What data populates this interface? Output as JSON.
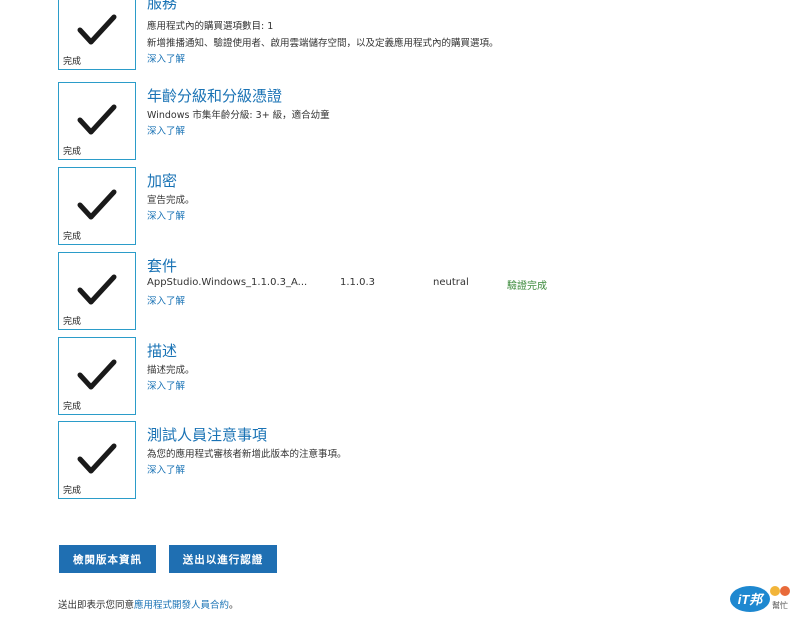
{
  "check_status_label": "完成",
  "sections": [
    {
      "title": "服務",
      "lines": [
        "應用程式內的購買選項數目: 1",
        "新增推播通知、驗證使用者、啟用雲端儲存空間，以及定義應用程式內的購買選項。"
      ],
      "link": "深入了解"
    },
    {
      "title": "年齡分級和分級憑證",
      "lines": [
        "Windows 市集年齡分級: 3+ 級，適合幼童"
      ],
      "link": "深入了解"
    },
    {
      "title": "加密",
      "lines": [
        "宣告完成。"
      ],
      "link": "深入了解"
    },
    {
      "title": "套件",
      "package": {
        "name": "AppStudio.Windows_1.1.0.3_A...",
        "version": "1.1.0.3",
        "architecture": "neutral",
        "status": "驗證完成"
      },
      "link": "深入了解"
    },
    {
      "title": "描述",
      "lines": [
        "描述完成。"
      ],
      "link": "深入了解"
    },
    {
      "title": "測試人員注意事項",
      "lines": [
        "為您的應用程式審核者新增此版本的注意事項。"
      ],
      "link": "深入了解"
    }
  ],
  "buttons": {
    "review_release": "檢閱版本資訊",
    "submit_for_certification": "送出以進行認證"
  },
  "agreement": {
    "prefix": "送出即表示您同意",
    "link": "應用程式開發人員合約",
    "suffix": "。"
  },
  "watermark": {
    "text": "iT邦",
    "subtext": "幫忙"
  },
  "colors": {
    "accent_blue": "#1a73b5",
    "button_blue": "#1f6fb2",
    "box_border": "#2b9cc9",
    "success_green": "#3a8a3a"
  }
}
